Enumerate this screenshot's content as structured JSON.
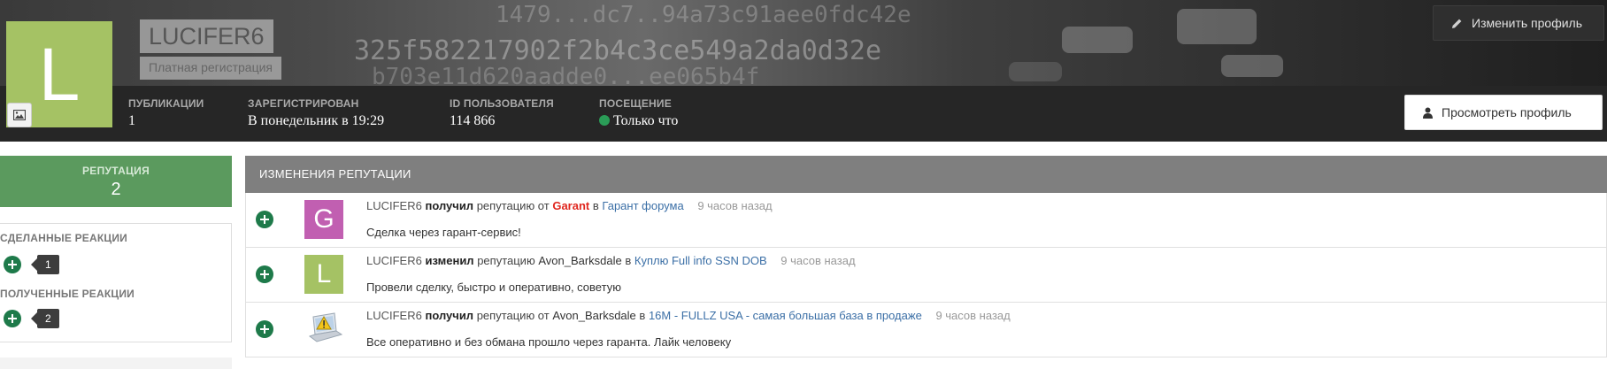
{
  "profile": {
    "avatar_letter": "L",
    "avatar_color": "#a5c264",
    "username": "LUCIFER6",
    "usergroup": "Платная регистрация",
    "stats": [
      {
        "label": "ПУБЛИКАЦИИ",
        "value": "1"
      },
      {
        "label": "ЗАРЕГИСТРИРОВАН",
        "value": "В понедельник в 19:29"
      },
      {
        "label": "ID ПОЛЬЗОВАТЕЛЯ",
        "value": "114 866"
      },
      {
        "label": "ПОСЕЩЕНИЕ",
        "value": "Только что"
      }
    ],
    "edit_profile_label": "Изменить профиль",
    "view_profile_label": "Просмотреть профиль",
    "cover_text": [
      "1479...dc7..94a73c91aee0fdc42e",
      "325f582217902f2b4c3ce549a2da0d32e",
      "b703e11d620aadde0...ee065b4f"
    ]
  },
  "sidebar": {
    "reputation_label": "РЕПУТАЦИЯ",
    "reputation_value": "2",
    "reputation_color": "#5b9a5e",
    "given_reactions_label": "СДЕЛАННЫЕ РЕАКЦИИ",
    "given_reactions_count": "1",
    "received_reactions_label": "ПОЛУЧЕННЫЕ РЕАКЦИИ",
    "received_reactions_count": "2",
    "reaction_icon": "plus-icon"
  },
  "reputation_changes": {
    "title": "ИЗМЕНЕНИЯ РЕПУТАЦИИ",
    "items": [
      {
        "avatar_letter": "G",
        "avatar_color": "#c15fb1",
        "user": "LUCIFER6",
        "verb": "получил",
        "mid": "репутацию от",
        "actor": "Garant",
        "in": "в",
        "topic": "Гарант форума",
        "time": "9 часов назад",
        "comment": "Сделка через гарант-сервис!"
      },
      {
        "avatar_letter": "L",
        "avatar_color": "#a5c264",
        "user": "LUCIFER6",
        "verb": "изменил",
        "mid": "репутацию",
        "actor": "Avon_Barksdale",
        "in": "в",
        "topic": "Куплю Full info SSN DOB",
        "time": "9 часов назад",
        "comment": "Провели сделку, быстро и оперативно, советую"
      },
      {
        "avatar_icon": "laptop-warning-icon",
        "user": "LUCIFER6",
        "verb": "получил",
        "mid": "репутацию от",
        "actor": "Avon_Barksdale",
        "in": "в",
        "topic": "16M - FULLZ USA - самая большая база в продаже",
        "time": "9 часов назад",
        "comment": "Все оперативно и без обмана прошло через гаранта. Лайк человеку"
      }
    ]
  }
}
